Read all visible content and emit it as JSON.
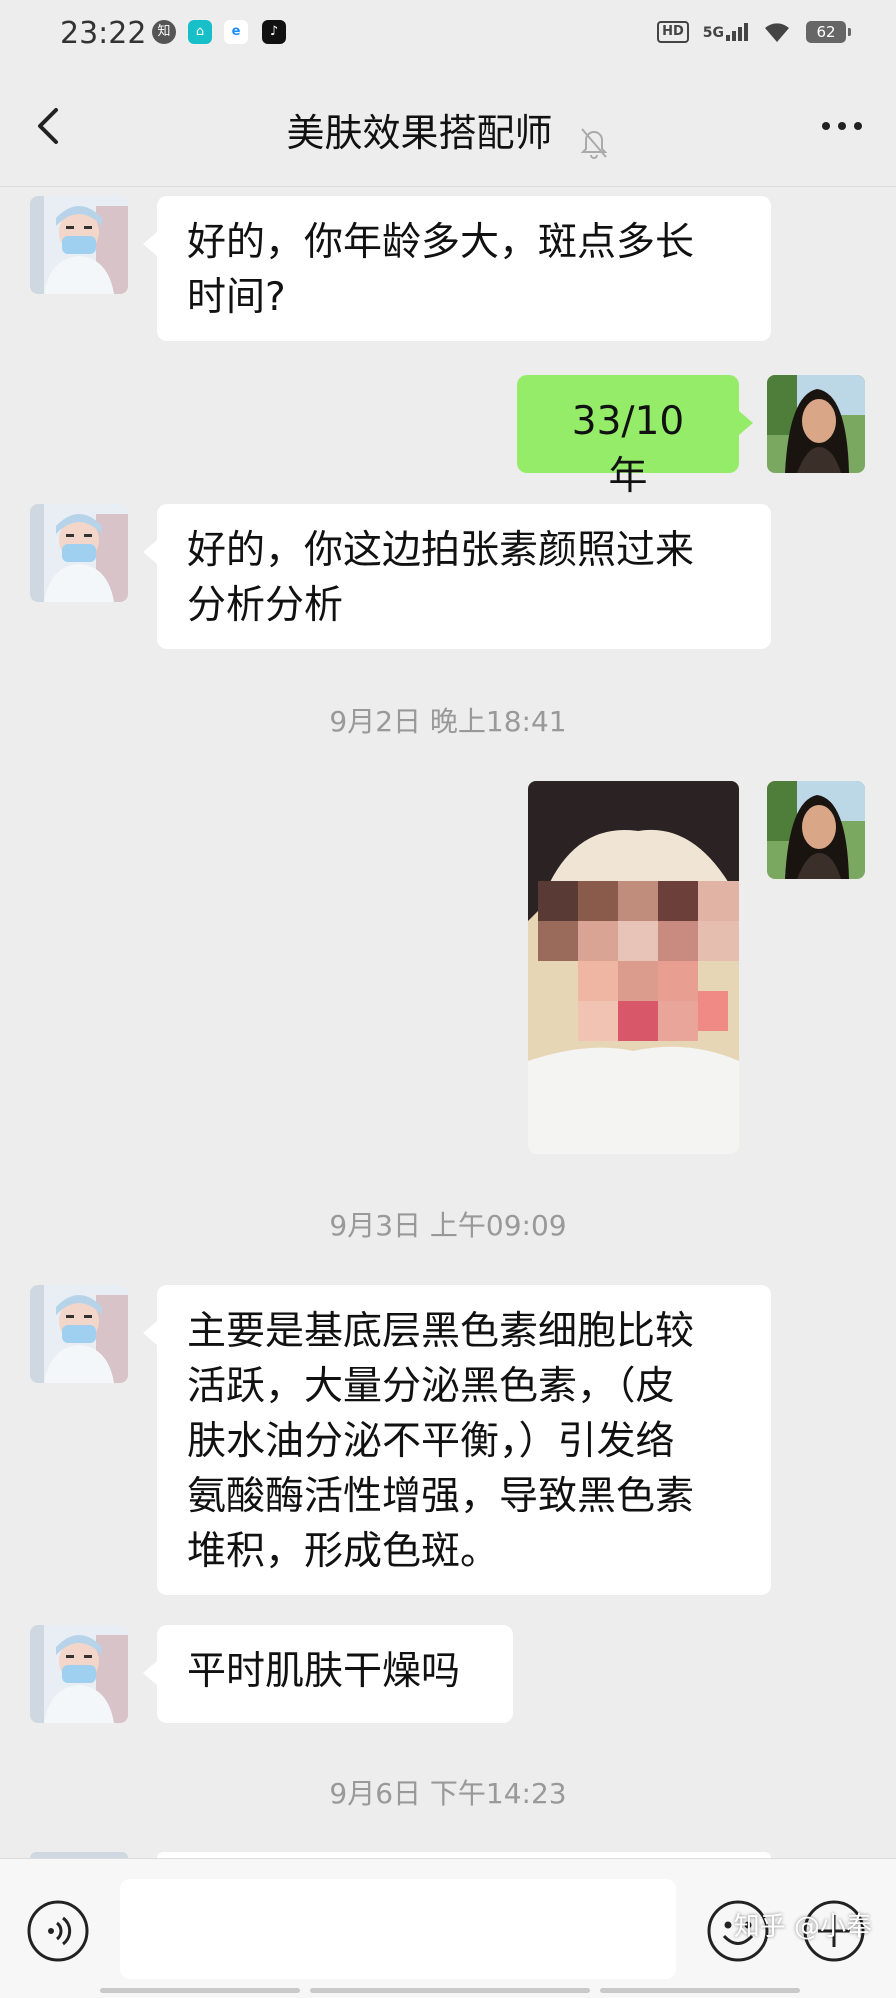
{
  "status_bar": {
    "time": "23:22",
    "apps": [
      "zhihu-icon",
      "app-icon",
      "browser-icon",
      "tiktok-icon"
    ],
    "hd": "HD",
    "network": "5G",
    "battery": "62"
  },
  "header": {
    "title": "美肤效果搭配师",
    "icons": [
      "back-icon",
      "mute-bell-icon",
      "more-icon"
    ]
  },
  "messages": [
    {
      "side": "left",
      "text_line1": "好的，你年龄多大，斑点多长",
      "text_line2": "时间?"
    },
    {
      "side": "right",
      "text": "33/10 年"
    },
    {
      "side": "left",
      "text_line1": "好的，你这边拍张素颜照过来",
      "text_line2": "分析分析"
    },
    {
      "timestamp": "9月2日 晚上18:41"
    },
    {
      "side": "right",
      "type": "image",
      "image": "selfie-photo-pixelated"
    },
    {
      "timestamp": "9月3日 上午09:09"
    },
    {
      "side": "left",
      "lines": [
        "主要是基底层黑色素细胞比较",
        "活跃，大量分泌黑色素，（皮",
        "肤水油分泌不平衡，）引发络",
        "氨酸酶活性增强，导致黑色素",
        "堆积，形成色斑。"
      ]
    },
    {
      "side": "left",
      "text": "平时肌肤干燥吗"
    },
    {
      "timestamp": "9月6日 下午14:23"
    }
  ],
  "timestamps": {
    "t1": "9月2日 晚上18:41",
    "t2": "9月3日 上午09:09",
    "t3": "9月6日 下午14:23"
  },
  "chat": {
    "m1_line1": "好的，你年龄多大，斑点多长",
    "m1_line2": "时间?",
    "m2": "33/10 年",
    "m3_line1": "好的，你这边拍张素颜照过来",
    "m3_line2": "分析分析",
    "m5_line1": "主要是基底层黑色素细胞比较",
    "m5_line2": "活跃，大量分泌黑色素，（皮",
    "m5_line3": "肤水油分泌不平衡，）引发络",
    "m5_line4": "氨酸酶活性增强，导致黑色素",
    "m5_line5": "堆积，形成色斑。",
    "m6": "平时肌肤干燥吗"
  },
  "input": {
    "value": "",
    "icons": [
      "voice-icon",
      "emoji-icon",
      "plus-icon"
    ]
  },
  "watermark": "知乎 @小奉",
  "colors": {
    "background": "#ededed",
    "self_bubble": "#95ec69",
    "other_bubble": "#ffffff",
    "timestamp": "#999999"
  }
}
